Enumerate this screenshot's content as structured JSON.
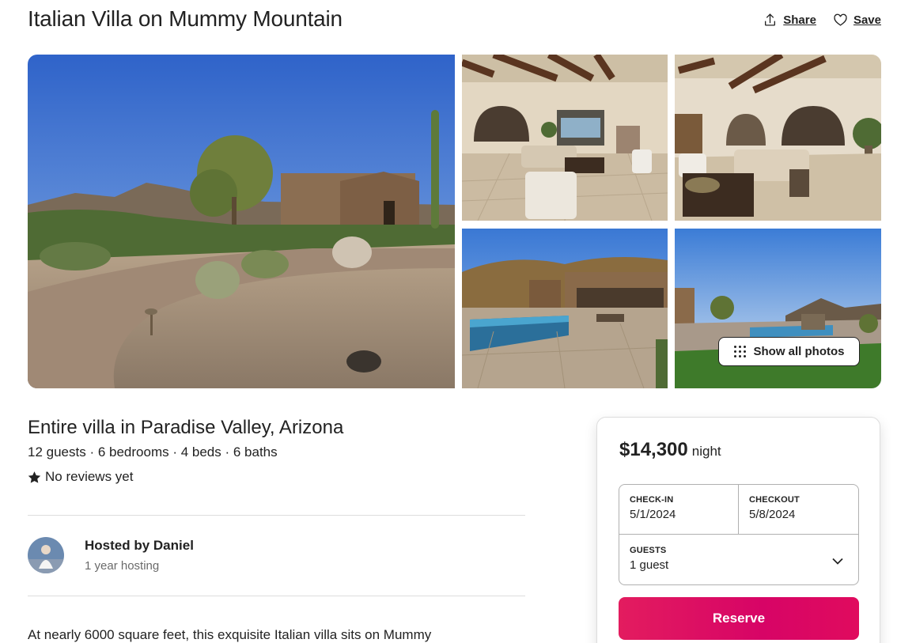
{
  "listing": {
    "title": "Italian Villa on Mummy Mountain",
    "subtitle": "Entire villa in Paradise Valley, Arizona",
    "details": "12 guests · 6 bedrooms · 4 beds · 6 baths",
    "reviews": "No reviews yet",
    "description": "At nearly 6000 square feet, this exquisite Italian villa sits on Mummy"
  },
  "actions": {
    "share_label": "Share",
    "save_label": "Save"
  },
  "gallery": {
    "show_all_label": "Show all photos",
    "photos": [
      "exterior-driveway",
      "living-room",
      "living-room-2",
      "pool-patio",
      "pool-view"
    ]
  },
  "host": {
    "name": "Hosted by Daniel",
    "years": "1 year hosting"
  },
  "booking": {
    "price": "$14,300",
    "price_unit": "night",
    "checkin_label": "CHECK-IN",
    "checkin_value": "5/1/2024",
    "checkout_label": "CHECKOUT",
    "checkout_value": "5/8/2024",
    "guests_label": "GUESTS",
    "guests_value": "1 guest",
    "reserve_label": "Reserve"
  },
  "colors": {
    "accent": "#e31c5f",
    "text": "#222222",
    "muted": "#6a6a6a",
    "divider": "#dddddd"
  }
}
